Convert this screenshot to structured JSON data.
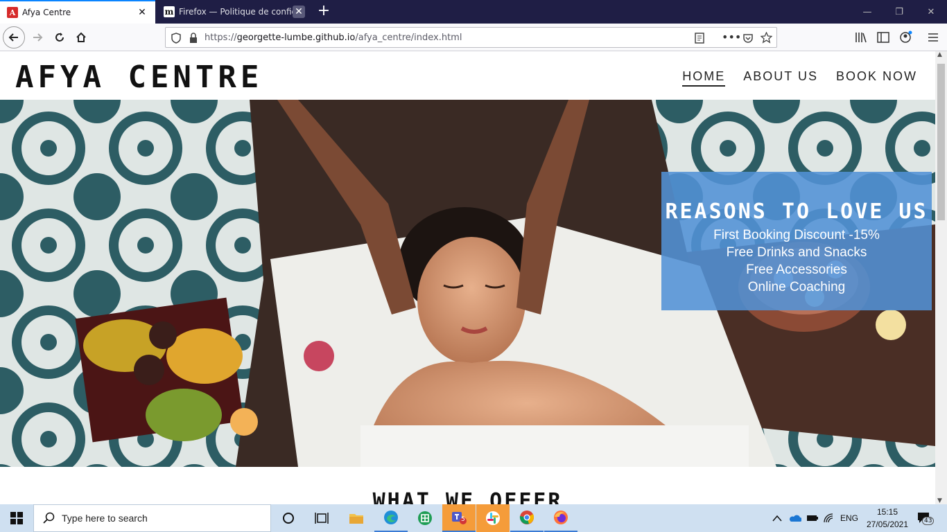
{
  "browser": {
    "tabs": [
      {
        "title": "Afya Centre",
        "favicon": "A",
        "active": true
      },
      {
        "title": "Firefox — Politique de confidentialité",
        "favicon": "m",
        "active": false
      }
    ],
    "url": {
      "scheme": "https://",
      "host": "georgette-lumbe.github.io",
      "path": "/afya_centre/index.html"
    }
  },
  "site": {
    "logo": "AFYA CENTRE",
    "nav": [
      {
        "label": "HOME",
        "current": true
      },
      {
        "label": "ABOUT US",
        "current": false
      },
      {
        "label": "BOOK NOW",
        "current": false
      }
    ],
    "reasons": {
      "title": "REASONS TO LOVE US",
      "items": [
        "First Booking Discount -15%",
        "Free Drinks and Snacks",
        "Free Accessories",
        "Online Coaching"
      ]
    },
    "section_title": "WHAT WE OFFER",
    "accent_color": "#5292d6"
  },
  "taskbar": {
    "search_placeholder": "Type here to search",
    "teams_badge": "5",
    "language": "ENG",
    "time": "15:15",
    "date": "27/05/2021",
    "notifications": "43"
  }
}
